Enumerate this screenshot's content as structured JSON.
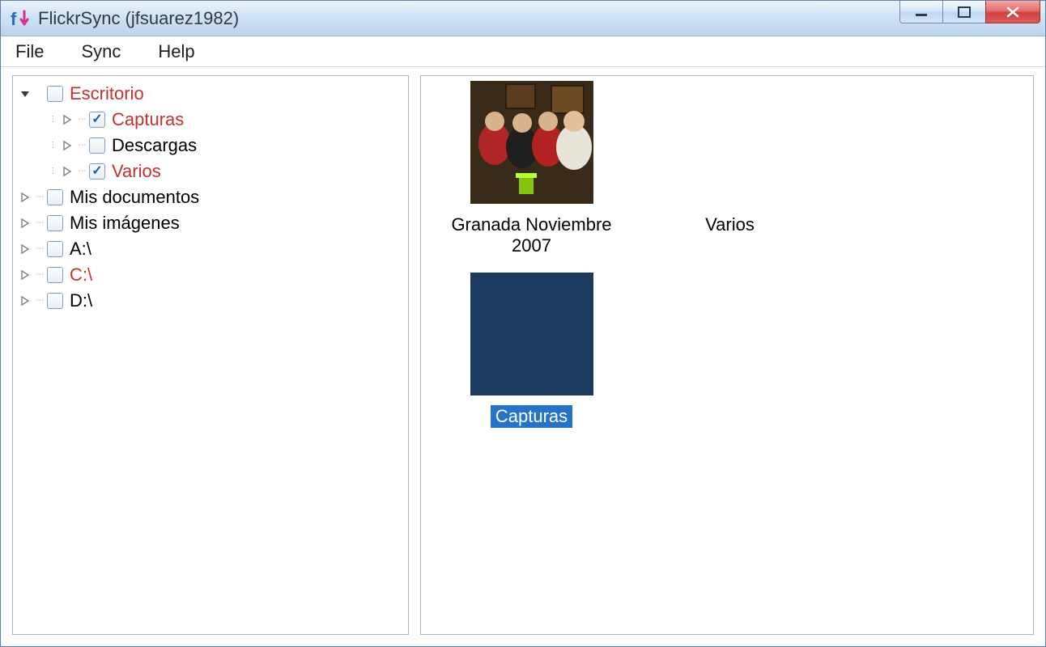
{
  "window": {
    "title": "FlickrSync (jfsuarez1982)"
  },
  "menu": {
    "file": "File",
    "sync": "Sync",
    "help": "Help"
  },
  "tree": {
    "root": {
      "label": "Escritorio",
      "expanded": true,
      "children": [
        {
          "label": "Capturas",
          "checked": true,
          "red": true
        },
        {
          "label": "Descargas",
          "checked": false,
          "red": false
        },
        {
          "label": "Varios",
          "checked": true,
          "red": true
        }
      ]
    },
    "top_nodes": [
      {
        "label": "Mis documentos",
        "red": false
      },
      {
        "label": "Mis imágenes",
        "red": false
      },
      {
        "label": "A:\\",
        "red": false
      },
      {
        "label": "C:\\",
        "red": true
      },
      {
        "label": "D:\\",
        "red": false
      }
    ]
  },
  "thumbs": [
    {
      "label": "Granada Noviembre 2007",
      "selected": false,
      "has_image": true
    },
    {
      "label": "Varios",
      "selected": false,
      "has_image": false
    },
    {
      "label": "Capturas",
      "selected": true,
      "has_image": true,
      "solid_color": "#1a3a5e"
    }
  ]
}
